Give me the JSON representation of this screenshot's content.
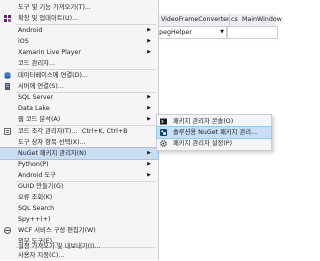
{
  "editor": {
    "tabs": [
      {
        "label": "VideoFrameConverter.cs"
      },
      {
        "label": "MainWindow"
      }
    ],
    "dropdown_value": "mpegHelper"
  },
  "menu": {
    "items": [
      {
        "label": "도구 및 기능 가져오기(T)..."
      },
      {
        "label": "확장 및 업데이트(U)..."
      },
      {
        "label": "Android"
      },
      {
        "label": "iOS"
      },
      {
        "label": "Xamarin Live Player"
      },
      {
        "label": "코드 관리자..."
      },
      {
        "label": "데이터베이스에 연결(D)..."
      },
      {
        "label": "서버에 연결(S)..."
      },
      {
        "label": "SQL Server"
      },
      {
        "label": "Data Lake"
      },
      {
        "label": "웹 코드 분석(A)"
      },
      {
        "label": "코드 조각 관리자(T)...",
        "shortcut": "Ctrl+K, Ctrl+B"
      },
      {
        "label": "도구 상자 항목 선택(X)..."
      },
      {
        "label": "NuGet 패키지 관리자(N)"
      },
      {
        "label": "Python(P)"
      },
      {
        "label": "Android 도구"
      },
      {
        "label": "GUID 만들기(G)"
      },
      {
        "label": "오류 조회(K)"
      },
      {
        "label": "SQL Search"
      },
      {
        "label": "Spy++(+)"
      },
      {
        "label": "WCF 서비스 구성 편집기(W)"
      },
      {
        "label": "외부 도구(E)..."
      },
      {
        "label": "설정 가져오기 및 내보내기(I)..."
      },
      {
        "label": "사용자 지정(C)..."
      }
    ]
  },
  "submenu": {
    "items": [
      {
        "label": "패키지 관리자 콘솔(O)"
      },
      {
        "label": "솔루션용 NuGet 패키지 관리..."
      },
      {
        "label": "패키지 관리자 설정(P)"
      }
    ]
  },
  "colors": {
    "highlight": "#c9def5",
    "menu_bg": "#f5f5f5"
  }
}
